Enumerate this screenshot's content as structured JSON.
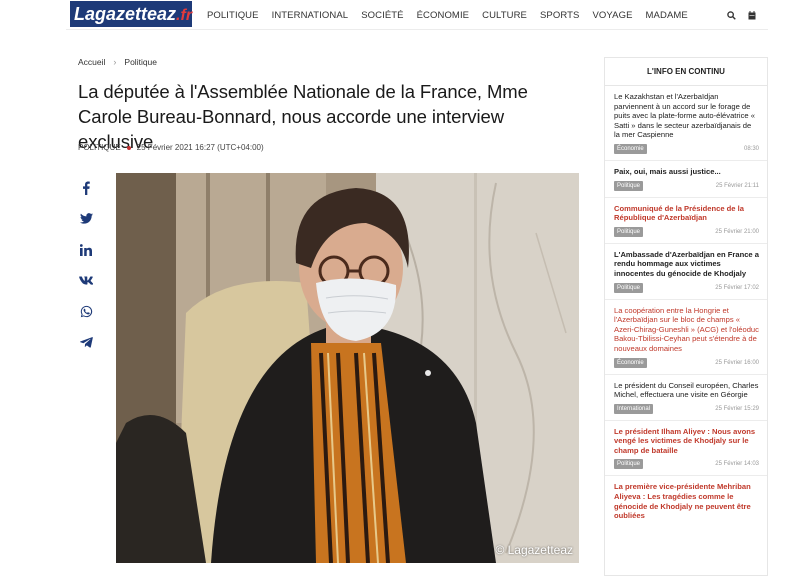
{
  "header": {
    "logo_main": "Lagazetteaz",
    "logo_suffix": ".fr",
    "nav": [
      "POLITIQUE",
      "INTERNATIONAL",
      "SOCIÉTÉ",
      "ÉCONOMIE",
      "CULTURE",
      "SPORTS",
      "VOYAGE",
      "MADAME"
    ]
  },
  "breadcrumb": {
    "home": "Accueil",
    "section": "Politique"
  },
  "article": {
    "title": "La députée à l'Assemblée Nationale de la France, Mme Carole Bureau-Bonnard, nous accorde une interview exclusive",
    "category": "POLITIQUE",
    "date": "25 Février 2021 16:27 (UTC+04:00)",
    "photo_credit": "© Lagazetteaz"
  },
  "share_icons": [
    "facebook-icon",
    "twitter-icon",
    "linkedin-icon",
    "vk-icon",
    "whatsapp-icon",
    "telegram-icon"
  ],
  "sidebar": {
    "title": "L'INFO EN CONTINU",
    "items": [
      {
        "text": "Le Kazakhstan et l'Azerbaïdjan parviennent à un accord sur le forage de puits avec la plate-forme auto-élévatrice « Satti » dans le secteur azerbaïdjanais de la mer Caspienne",
        "badge": "Économie",
        "time": "08:30",
        "style": "normal"
      },
      {
        "text": "Paix, oui, mais aussi justice...",
        "badge": "Politique",
        "time": "25 Février 21:11",
        "style": "bold"
      },
      {
        "text": "Communiqué de la Présidence de la République d'Azerbaïdjan",
        "badge": "Politique",
        "time": "25 Février 21:00",
        "style": "red"
      },
      {
        "text": "L'Ambassade d'Azerbaïdjan en France a rendu hommage aux victimes innocentes du génocide de Khodjaly",
        "badge": "Politique",
        "time": "25 Février 17:02",
        "style": "bold"
      },
      {
        "text": "La coopération entre la Hongrie et l'Azerbaïdjan sur le bloc de champs « Azeri-Chirag-Guneshli » (ACG) et l'oléoduc Bakou-Tbilissi-Ceyhan peut s'étendre à de nouveaux domaines",
        "badge": "Économie",
        "time": "25 Février 16:00",
        "style": "redlight"
      },
      {
        "text": "Le président du Conseil européen, Charles Michel, effectuera une visite en Géorgie",
        "badge": "International",
        "time": "25 Février 15:29",
        "style": "normal"
      },
      {
        "text": "Le président Ilham Aliyev : Nous avons vengé les victimes de Khodjaly sur le champ de bataille",
        "badge": "Politique",
        "time": "25 Février 14:03",
        "style": "red"
      },
      {
        "text": "La première vice-présidente Mehriban Aliyeva : Les tragédies comme le génocide de Khodjaly ne peuvent être oubliées",
        "badge": "",
        "time": "",
        "style": "red"
      }
    ]
  }
}
